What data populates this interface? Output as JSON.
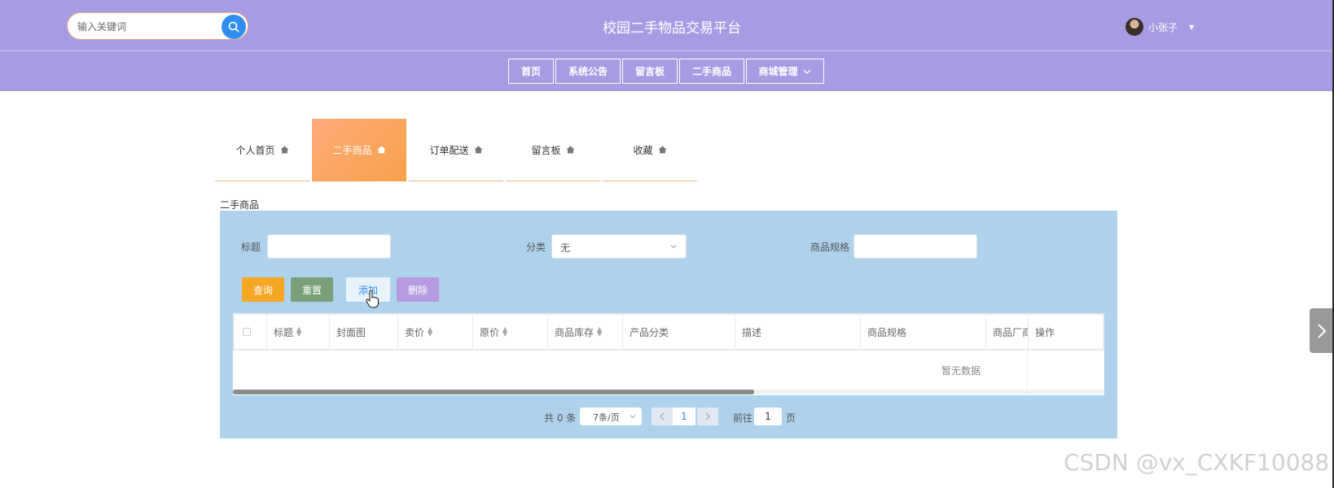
{
  "header": {
    "search_placeholder": "输入关键词",
    "site_title": "校园二手物品交易平台",
    "user_name": "小张子"
  },
  "nav": [
    {
      "label": "首页"
    },
    {
      "label": "系统公告"
    },
    {
      "label": "留言板"
    },
    {
      "label": "二手商品"
    },
    {
      "label": "商城管理"
    }
  ],
  "tabs": [
    {
      "label": "个人首页",
      "active": false
    },
    {
      "label": "二手商品",
      "active": true
    },
    {
      "label": "订单配送",
      "active": false
    },
    {
      "label": "留言板",
      "active": false
    },
    {
      "label": "收藏",
      "active": false
    }
  ],
  "section_title": "二手商品",
  "filters": {
    "title_label": "标题",
    "category_label": "分类",
    "category_value": "无",
    "spec_label": "商品规格"
  },
  "actions": {
    "query": "查询",
    "reset": "重置",
    "add": "添加",
    "delete": "删除"
  },
  "table": {
    "columns": [
      "标题",
      "封面图",
      "卖价",
      "原价",
      "商品库存",
      "产品分类",
      "描述",
      "商品规格",
      "商品厂商",
      "操作"
    ],
    "empty_text": "暂无数据"
  },
  "pagination": {
    "total_text": "共 0 条",
    "page_size": "7条/页",
    "current_page": "1",
    "goto_label": "前往",
    "goto_value": "1",
    "page_suffix": "页"
  },
  "watermark": "CSDN @vx_CXKF10088",
  "colors": {
    "header_bg": "#a79be3",
    "panel_bg": "#aed2ec",
    "tab_active": "#f7a14a",
    "query_btn": "#f5a623",
    "reset_btn": "#7aa07a",
    "add_btn": "#e8f2fb",
    "delete_btn": "#b69be0",
    "accent": "#2f8ef0"
  },
  "icons": {
    "search": "search-icon",
    "tab": "house-icon",
    "side": "chevron-right-icon"
  }
}
